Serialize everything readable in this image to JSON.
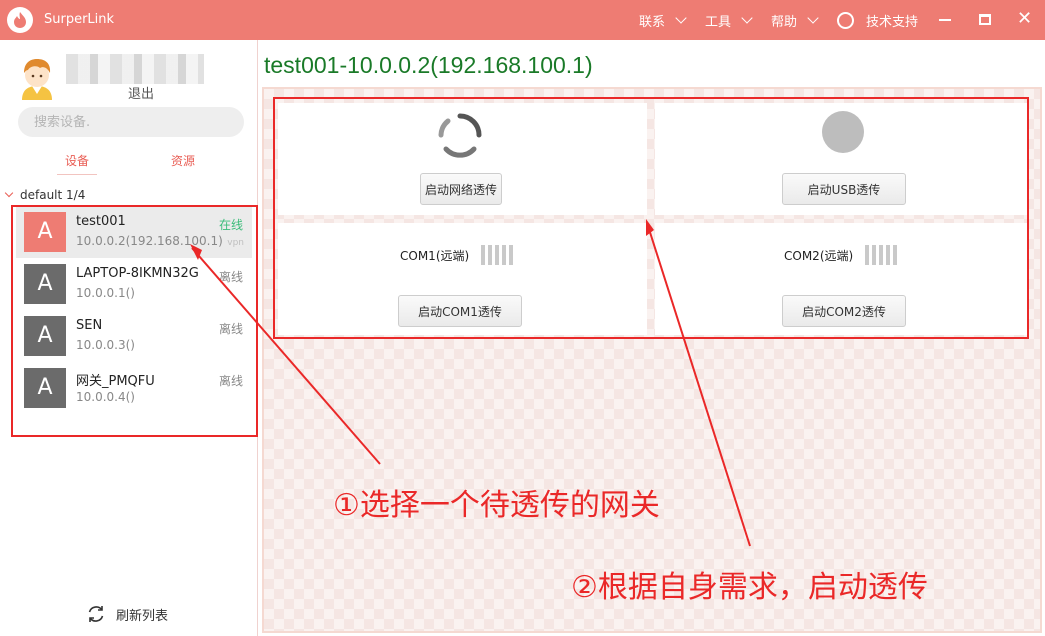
{
  "app": {
    "title": "SurperLink"
  },
  "menu": {
    "contact": "联系",
    "tools": "工具",
    "help": "帮助",
    "support": "技术支持"
  },
  "sidebar": {
    "logout": "退出",
    "search_placeholder": "搜索设备.",
    "tabs": {
      "devices": "设备",
      "resources": "资源"
    },
    "group": {
      "name": "default 1/4"
    },
    "devices": [
      {
        "avatar": "A",
        "name": "test001",
        "ip": "10.0.0.2(192.168.100.1)",
        "status": "在线",
        "tag": "vpn"
      },
      {
        "avatar": "A",
        "name": "LAPTOP-8IKMN32G",
        "ip": "10.0.0.1()",
        "status": "离线"
      },
      {
        "avatar": "A",
        "name": "SEN",
        "ip": "10.0.0.3()",
        "status": "离线"
      },
      {
        "avatar": "A",
        "name": "网关_PMQFU",
        "ip": "10.0.0.4()",
        "status": "离线"
      }
    ],
    "refresh_label": "刷新列表"
  },
  "main": {
    "title": "test001-10.0.0.2(192.168.100.1)",
    "network_button": "启动网络透传",
    "usb_button": "启动USB透传",
    "com1_label": "COM1(远端)",
    "com1_button": "启动COM1透传",
    "com2_label": "COM2(远端)",
    "com2_button": "启动COM2透传"
  },
  "annotations": {
    "step1": "①选择一个待透传的网关",
    "step2": "②根据自身需求，启动透传"
  },
  "colors": {
    "titlebar": "#ee7c73",
    "accent": "#e95e55",
    "online": "#3cbd7a",
    "title_green": "#1a7a28",
    "annotation": "#ea2828"
  }
}
